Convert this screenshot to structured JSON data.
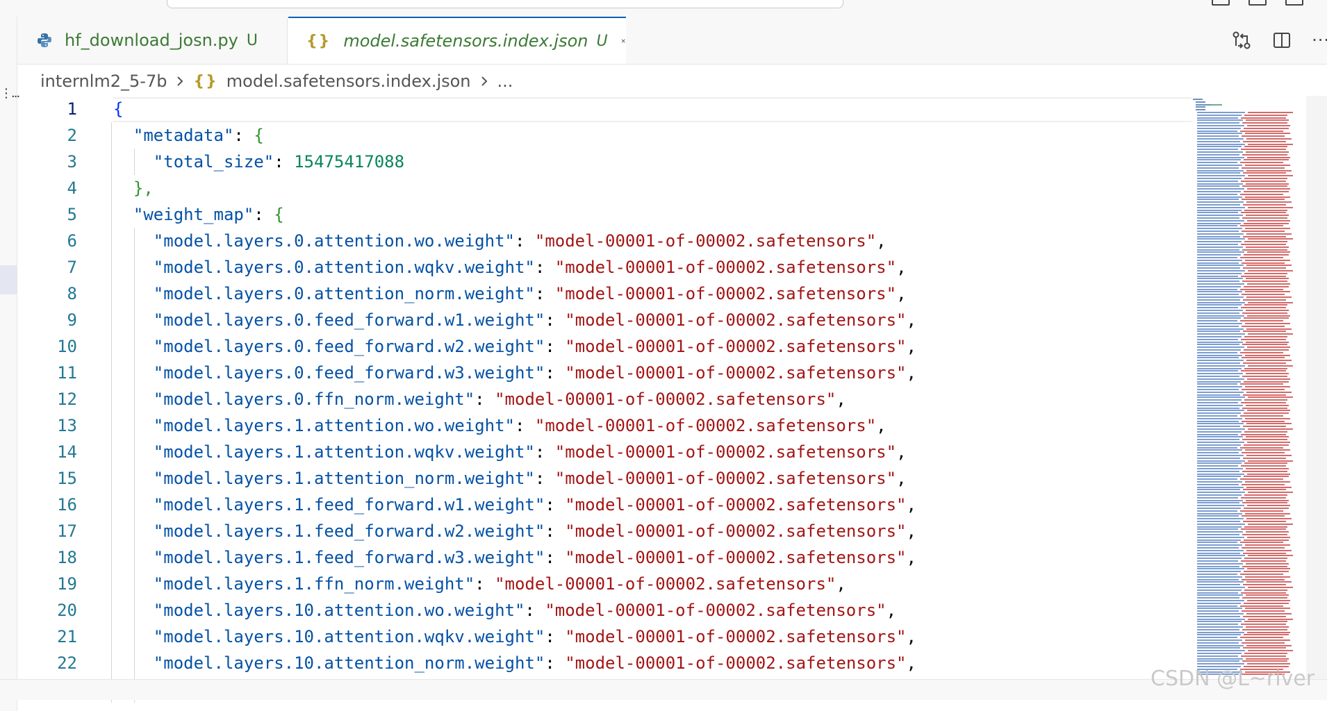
{
  "tabs": [
    {
      "label": "hf_download_josn.py",
      "badge": "U",
      "icon": "python-icon",
      "active": false
    },
    {
      "label": "model.safetensors.index.json",
      "badge": "U",
      "icon": "json-braces-icon",
      "active": true
    }
  ],
  "breadcrumb": {
    "folder": "internlm2_5-7b",
    "file_icon": "{}",
    "file": "model.safetensors.index.json",
    "tail": "..."
  },
  "editor": {
    "current_line": 1,
    "lines": [
      {
        "n": "1",
        "indent": 0,
        "open": "{"
      },
      {
        "n": "2",
        "indent": 1,
        "key": "\"metadata\"",
        "open2": "{"
      },
      {
        "n": "3",
        "indent": 2,
        "key": "\"total_size\"",
        "num": "15475417088"
      },
      {
        "n": "4",
        "indent": 1,
        "close": "},"
      },
      {
        "n": "5",
        "indent": 1,
        "key": "\"weight_map\"",
        "open2": "{"
      },
      {
        "n": "6",
        "indent": 2,
        "key": "\"model.layers.0.attention.wo.weight\"",
        "str": "\"model-00001-of-00002.safetensors\""
      },
      {
        "n": "7",
        "indent": 2,
        "key": "\"model.layers.0.attention.wqkv.weight\"",
        "str": "\"model-00001-of-00002.safetensors\""
      },
      {
        "n": "8",
        "indent": 2,
        "key": "\"model.layers.0.attention_norm.weight\"",
        "str": "\"model-00001-of-00002.safetensors\""
      },
      {
        "n": "9",
        "indent": 2,
        "key": "\"model.layers.0.feed_forward.w1.weight\"",
        "str": "\"model-00001-of-00002.safetensors\""
      },
      {
        "n": "10",
        "indent": 2,
        "key": "\"model.layers.0.feed_forward.w2.weight\"",
        "str": "\"model-00001-of-00002.safetensors\""
      },
      {
        "n": "11",
        "indent": 2,
        "key": "\"model.layers.0.feed_forward.w3.weight\"",
        "str": "\"model-00001-of-00002.safetensors\""
      },
      {
        "n": "12",
        "indent": 2,
        "key": "\"model.layers.0.ffn_norm.weight\"",
        "str": "\"model-00001-of-00002.safetensors\""
      },
      {
        "n": "13",
        "indent": 2,
        "key": "\"model.layers.1.attention.wo.weight\"",
        "str": "\"model-00001-of-00002.safetensors\""
      },
      {
        "n": "14",
        "indent": 2,
        "key": "\"model.layers.1.attention.wqkv.weight\"",
        "str": "\"model-00001-of-00002.safetensors\""
      },
      {
        "n": "15",
        "indent": 2,
        "key": "\"model.layers.1.attention_norm.weight\"",
        "str": "\"model-00001-of-00002.safetensors\""
      },
      {
        "n": "16",
        "indent": 2,
        "key": "\"model.layers.1.feed_forward.w1.weight\"",
        "str": "\"model-00001-of-00002.safetensors\""
      },
      {
        "n": "17",
        "indent": 2,
        "key": "\"model.layers.1.feed_forward.w2.weight\"",
        "str": "\"model-00001-of-00002.safetensors\""
      },
      {
        "n": "18",
        "indent": 2,
        "key": "\"model.layers.1.feed_forward.w3.weight\"",
        "str": "\"model-00001-of-00002.safetensors\""
      },
      {
        "n": "19",
        "indent": 2,
        "key": "\"model.layers.1.ffn_norm.weight\"",
        "str": "\"model-00001-of-00002.safetensors\""
      },
      {
        "n": "20",
        "indent": 2,
        "key": "\"model.layers.10.attention.wo.weight\"",
        "str": "\"model-00001-of-00002.safetensors\""
      },
      {
        "n": "21",
        "indent": 2,
        "key": "\"model.layers.10.attention.wqkv.weight\"",
        "str": "\"model-00001-of-00002.safetensors\""
      },
      {
        "n": "22",
        "indent": 2,
        "key": "\"model.layers.10.attention_norm.weight\"",
        "str": "\"model-00001-of-00002.safetensors\""
      }
    ]
  },
  "icons": {
    "tab_actions": [
      "open-changes-icon",
      "split-editor-icon",
      "more-actions-icon"
    ],
    "more": "···"
  },
  "activity_more": "⋮...",
  "watermark": "CSDN @L~river",
  "colors": {
    "accent": "#005fb8",
    "json_key": "#0451a5",
    "json_string": "#a31515",
    "json_number": "#098658",
    "untracked": "#3b7a34"
  }
}
